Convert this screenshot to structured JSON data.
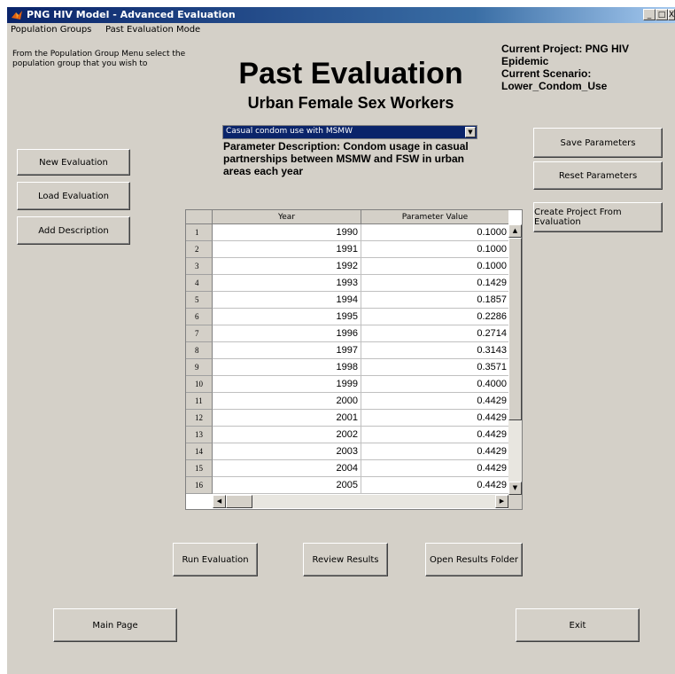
{
  "window": {
    "title": "PNG HIV Model - Advanced Evaluation",
    "minimize": "_",
    "maximize": "□",
    "close": "X"
  },
  "menu": [
    "Population Groups",
    "Past Evaluation Mode"
  ],
  "intro_text": "From the Population Group Menu select the population group that you wish to",
  "heading": {
    "title": "Past Evaluation",
    "subtitle": "Urban Female Sex Workers"
  },
  "project": {
    "project_line1": "Current Project: PNG HIV",
    "project_line2": "Epidemic",
    "scenario_label": "Current Scenario:",
    "scenario_value": "Lower_Condom_Use"
  },
  "parameter_select": {
    "selected": "Casual condom use with MSMW"
  },
  "parameter_description": "Parameter Description: Condom usage in casual partnerships between MSMW and FSW in urban areas each year",
  "left_buttons": {
    "new_evaluation": "New Evaluation",
    "load_evaluation": "Load Evaluation",
    "add_description": "Add Description"
  },
  "right_buttons": {
    "save_parameters": "Save Parameters",
    "reset_parameters": "Reset Parameters",
    "create_project": "Create Project From Evaluation"
  },
  "table": {
    "columns": [
      "Year",
      "Parameter Value"
    ],
    "rows": [
      {
        "n": "1",
        "year": "1990",
        "value": "0.1000"
      },
      {
        "n": "2",
        "year": "1991",
        "value": "0.1000"
      },
      {
        "n": "3",
        "year": "1992",
        "value": "0.1000"
      },
      {
        "n": "4",
        "year": "1993",
        "value": "0.1429"
      },
      {
        "n": "5",
        "year": "1994",
        "value": "0.1857"
      },
      {
        "n": "6",
        "year": "1995",
        "value": "0.2286"
      },
      {
        "n": "7",
        "year": "1996",
        "value": "0.2714"
      },
      {
        "n": "8",
        "year": "1997",
        "value": "0.3143"
      },
      {
        "n": "9",
        "year": "1998",
        "value": "0.3571"
      },
      {
        "n": "10",
        "year": "1999",
        "value": "0.4000"
      },
      {
        "n": "11",
        "year": "2000",
        "value": "0.4429"
      },
      {
        "n": "12",
        "year": "2001",
        "value": "0.4429"
      },
      {
        "n": "13",
        "year": "2002",
        "value": "0.4429"
      },
      {
        "n": "14",
        "year": "2003",
        "value": "0.4429"
      },
      {
        "n": "15",
        "year": "2004",
        "value": "0.4429"
      },
      {
        "n": "16",
        "year": "2005",
        "value": "0.4429"
      }
    ]
  },
  "bottom_buttons": {
    "run_evaluation": "Run Evaluation",
    "review_results": "Review Results",
    "open_results_folder": "Open Results Folder",
    "main_page": "Main Page",
    "exit": "Exit"
  },
  "colors": {
    "window_bg": "#d4d0c8",
    "title_bar": "#0a246a",
    "selection": "#0a246a"
  }
}
